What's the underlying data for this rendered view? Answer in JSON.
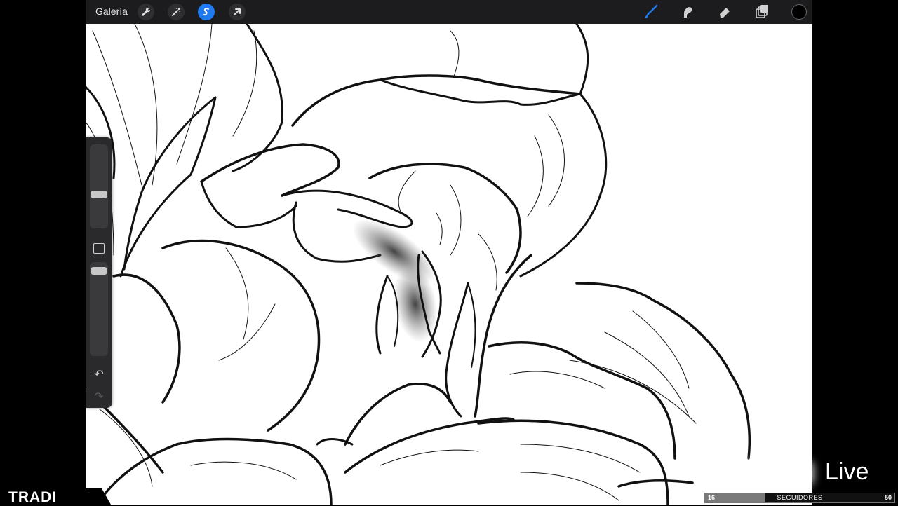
{
  "toolbar": {
    "gallery_label": "Galería",
    "left_tools": [
      "wrench-icon",
      "magic-wand-icon",
      "selection-icon",
      "transform-arrow-icon"
    ],
    "active_tool": "selection-icon",
    "right_tools": [
      "brush-icon",
      "smudge-icon",
      "eraser-icon",
      "layers-icon"
    ],
    "brush_color": "#1f7aef",
    "current_color": "#000000"
  },
  "sidebar": {
    "brush_size_level": 0.39,
    "opacity_level": 0.94,
    "undo_icon": "undo-icon",
    "redo_icon": "redo-icon"
  },
  "overlay": {
    "brand": "TRADI",
    "live_text": "Live",
    "followers": {
      "current": "16",
      "label": "SEGUIDORES",
      "goal": "50",
      "progress": 0.32
    }
  }
}
